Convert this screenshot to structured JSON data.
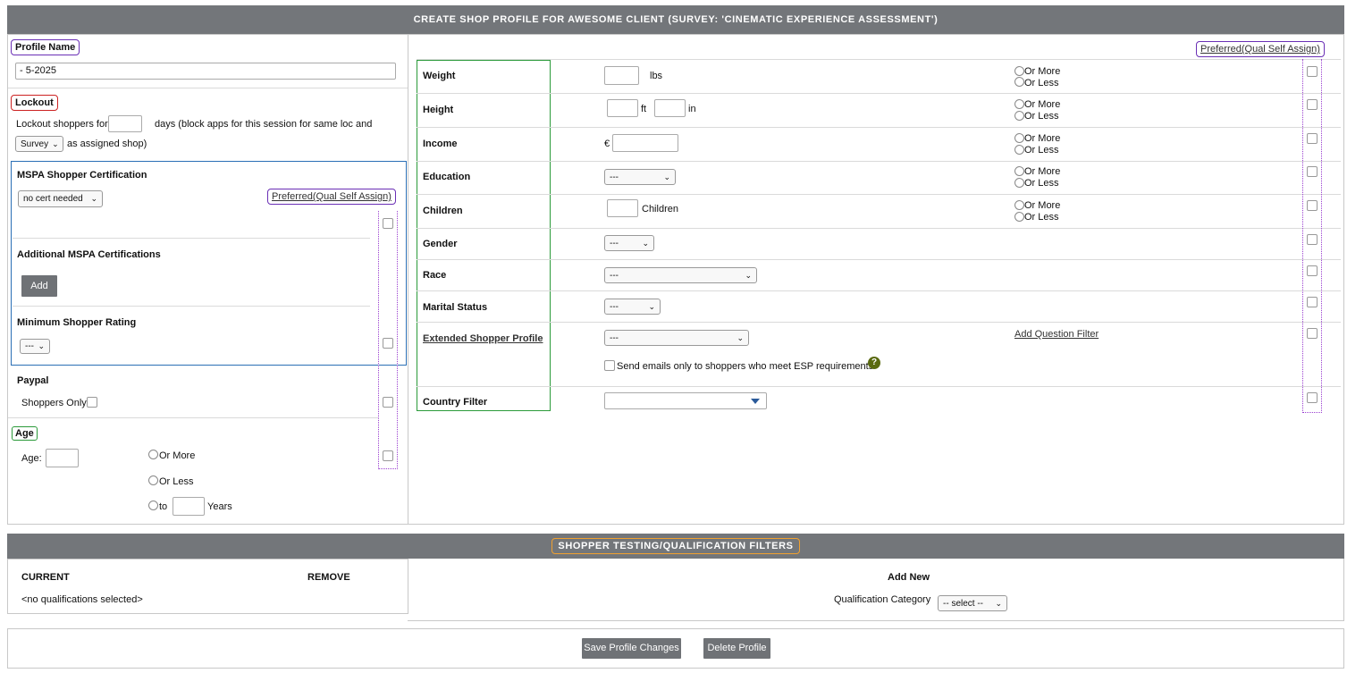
{
  "header": {
    "title": "CREATE SHOP PROFILE FOR AWESOME CLIENT (SURVEY: 'CINEMATIC EXPERIENCE ASSESSMENT')"
  },
  "left": {
    "profile_name_label": "Profile Name",
    "profile_name_value": "- 5-2025",
    "lockout_label": "Lockout",
    "lockout_text1": "Lockout shoppers for",
    "lockout_text2": "days (block apps for this session for same loc and",
    "lockout_select": "Survey",
    "lockout_text3": "as assigned shop)",
    "mspa_label": "MSPA Shopper Certification",
    "mspa_select": "no cert needed",
    "preferred_link": "Preferred(Qual Self Assign)",
    "additional_label": "Additional MSPA Certifications",
    "add_button": "Add",
    "min_rating_label": "Minimum Shopper Rating",
    "min_rating_select": "---",
    "paypal_label": "Paypal",
    "paypal_text": "Shoppers Only",
    "age_label": "Age",
    "age_field_label": "Age:",
    "age_or_more": "Or More",
    "age_or_less": "Or Less",
    "age_to": "to",
    "age_years": "Years"
  },
  "right": {
    "preferred_link": "Preferred(Qual Self Assign)",
    "weight_label": "Weight",
    "weight_unit": "lbs",
    "height_label": "Height",
    "height_ft": "ft",
    "height_in": "in",
    "income_label": "Income",
    "income_currency": "€",
    "education_label": "Education",
    "education_select": "---",
    "children_label": "Children",
    "children_unit": "Children",
    "gender_label": "Gender",
    "gender_select": "---",
    "race_label": "Race",
    "race_select": "---",
    "marital_label": "Marital Status",
    "marital_select": "---",
    "esp_label": "Extended Shopper Profile",
    "esp_select": "---",
    "add_question_filter": "Add Question Filter",
    "esp_checkbox_text": "Send emails only to shoppers who meet ESP requirements",
    "country_label": "Country Filter",
    "or_more": "Or More",
    "or_less": "Or Less"
  },
  "qual": {
    "title": "SHOPPER TESTING/QUALIFICATION FILTERS",
    "current_label": "CURRENT",
    "remove_label": "REMOVE",
    "none_text": "<no qualifications selected>",
    "add_new_label": "Add New",
    "category_label": "Qualification Category",
    "category_select": "-- select --"
  },
  "footer": {
    "save_button": "Save Profile Changes",
    "delete_button": "Delete Profile"
  },
  "colors": {
    "header_bg": "#73767a",
    "purple": "#6a2fb5",
    "red": "#cc2222",
    "green": "#2b9a3a",
    "blue": "#2a6fb5",
    "orange": "#f0a030"
  }
}
